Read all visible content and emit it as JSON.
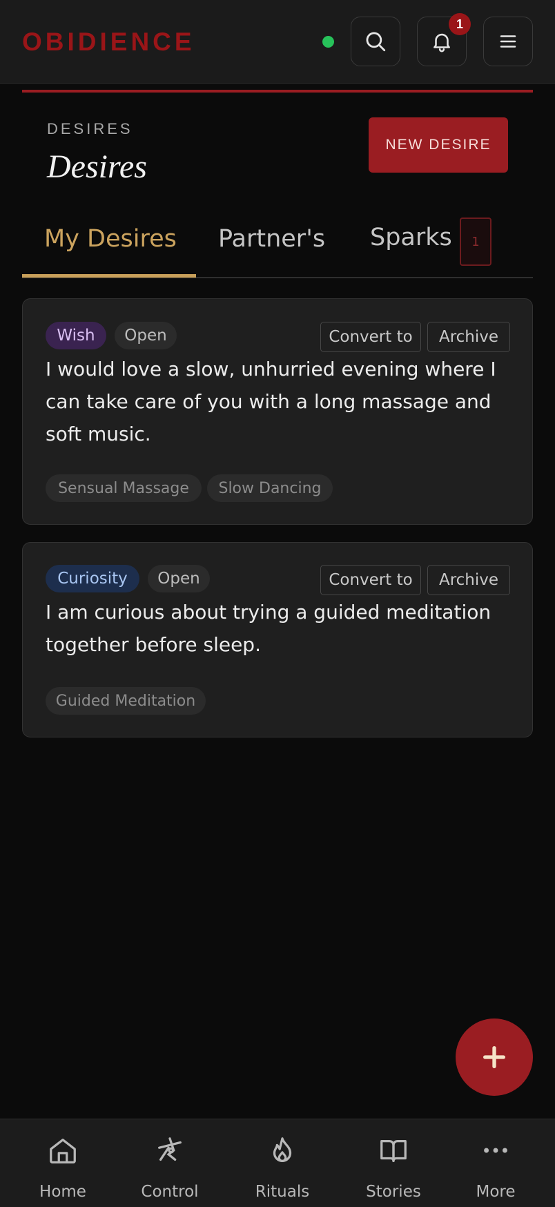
{
  "header": {
    "brand": "OBIDIENCE",
    "notification_count": "1",
    "icons": [
      "search-icon",
      "bell-icon",
      "menu-icon"
    ],
    "status": "online"
  },
  "page": {
    "eyebrow": "DESIRES",
    "title": "Desires",
    "new_button": "NEW DESIRE"
  },
  "tabs": [
    {
      "label": "My Desires",
      "active": true
    },
    {
      "label": "Partner's",
      "active": false
    },
    {
      "label": "Sparks",
      "active": false,
      "count": "1"
    }
  ],
  "desires": [
    {
      "type": "Wish",
      "status": "Open",
      "convert_label": "Convert to",
      "archive_label": "Archive",
      "text": "I would love a slow, unhurried evening where I can take care of you with a long massage and soft music.",
      "tags": [
        "Sensual Massage",
        "Slow Dancing"
      ]
    },
    {
      "type": "Curiosity",
      "status": "Open",
      "convert_label": "Convert to",
      "archive_label": "Archive",
      "text": "I am curious about trying a guided meditation together before sleep.",
      "tags": [
        "Guided Meditation"
      ]
    }
  ],
  "fab": {
    "icon": "plus-icon"
  },
  "nav": [
    {
      "label": "Home",
      "icon": "home-icon"
    },
    {
      "label": "Control",
      "icon": "control-icon"
    },
    {
      "label": "Rituals",
      "icon": "flame-icon"
    },
    {
      "label": "Stories",
      "icon": "book-icon"
    },
    {
      "label": "More",
      "icon": "more-icon"
    }
  ],
  "colors": {
    "brand": "#9a1518",
    "accent_gold": "#c9a05a",
    "status_online": "#27c25a",
    "background": "#0b0b0b"
  }
}
